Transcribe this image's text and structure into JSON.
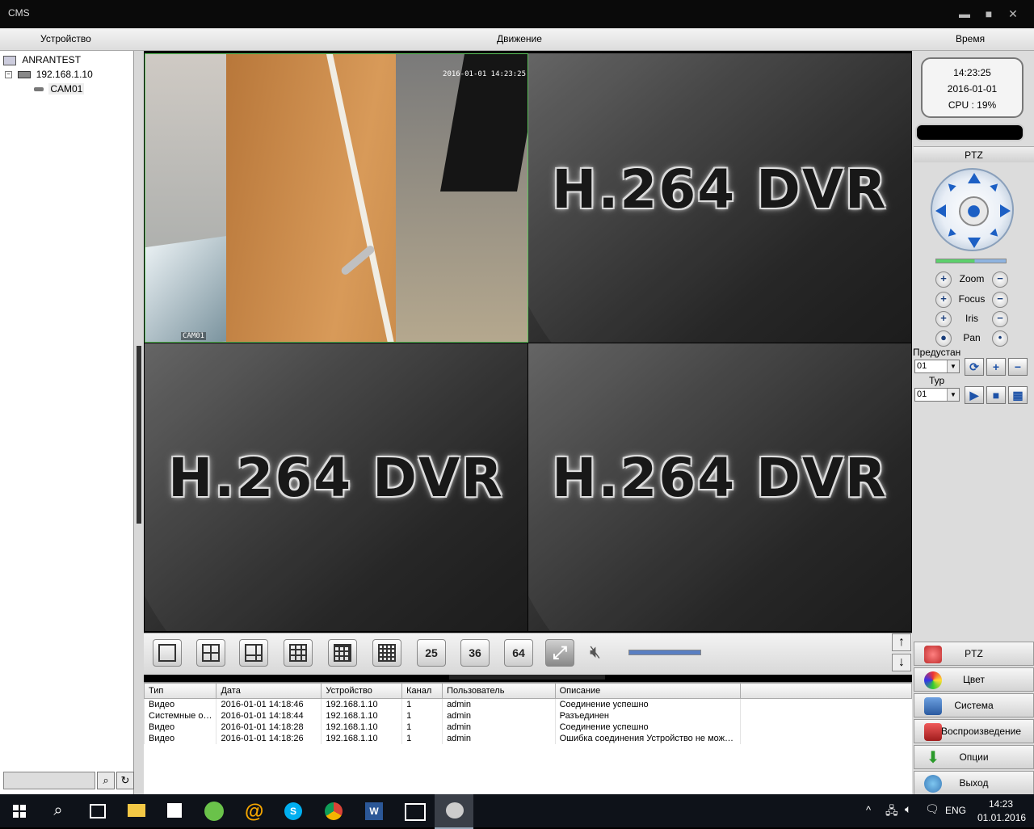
{
  "window": {
    "title": "CMS",
    "min_icon": "minimize-icon",
    "max_icon": "maximize-icon",
    "close_icon": "close-icon"
  },
  "header": {
    "device": "Устройство",
    "motion": "Движение",
    "time": "Время"
  },
  "tree": {
    "root": "ANRANTEST",
    "device": "192.168.1.10",
    "camera": "CAM01"
  },
  "video": {
    "cam1_timestamp": "2016-01-01 14:23:25",
    "cam1_label": "CAM01",
    "placeholder": "H.264 DVR"
  },
  "status": {
    "time": "14:23:25",
    "date": "2016-01-01",
    "cpu": "CPU : 19%"
  },
  "ptz": {
    "header": "PTZ",
    "zoom": "Zoom",
    "focus": "Focus",
    "iris": "Iris",
    "pan": "Pan",
    "preset_label": "Предустан",
    "preset_value": "01",
    "tour_label": "Тур",
    "tour_value": "01"
  },
  "layout_buttons": [
    "25",
    "36",
    "64"
  ],
  "menu": {
    "ptz": "PTZ",
    "color": "Цвет",
    "system": "Система",
    "playback": "Воспроизведение",
    "options": "Опции",
    "exit": "Выход"
  },
  "log": {
    "columns": [
      "Тип",
      "Дата",
      "Устройство",
      "Канал",
      "Пользователь",
      "Описание"
    ],
    "rows": [
      [
        "Видео",
        "2016-01-01 14:18:46",
        "192.168.1.10",
        "1",
        "admin",
        "Соединение успешно"
      ],
      [
        "Системные о…",
        "2016-01-01 14:18:44",
        "192.168.1.10",
        "1",
        "admin",
        "Разъединен"
      ],
      [
        "Видео",
        "2016-01-01 14:18:28",
        "192.168.1.10",
        "1",
        "admin",
        "Соединение успешно"
      ],
      [
        "Видео",
        "2016-01-01 14:18:26",
        "192.168.1.10",
        "1",
        "admin",
        "Ошибка соединения Устройство не мож…"
      ]
    ]
  },
  "taskbar": {
    "lang": "ENG",
    "time": "14:23",
    "date": "01.01.2016"
  },
  "colors": {
    "active_cell_border": "#5cc35c",
    "ptz_blue": "#1c5fc4",
    "taskbar": "#0e1219"
  }
}
